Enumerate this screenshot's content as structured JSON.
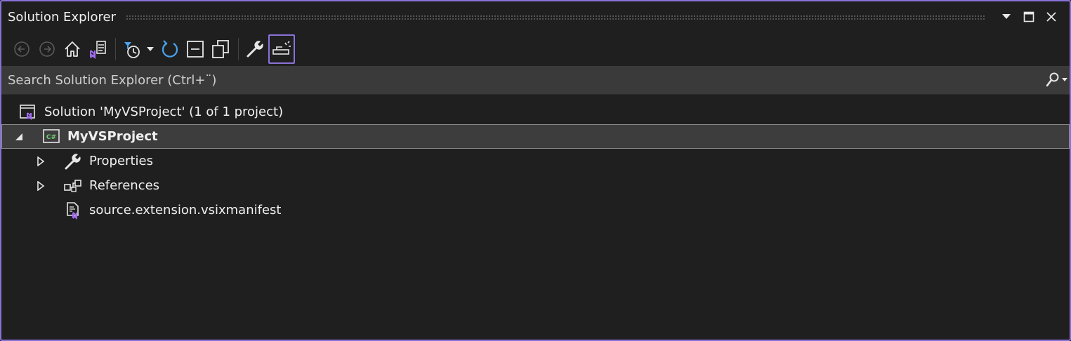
{
  "window": {
    "title": "Solution Explorer"
  },
  "toolbar": {
    "icons": [
      "back-icon",
      "forward-icon",
      "home-icon",
      "switch-views-icon",
      "pending-changes-filter-icon",
      "dropdown-arrow-icon",
      "sync-icon",
      "collapse-all-icon",
      "show-all-files-icon",
      "properties-icon",
      "preview-selected-icon"
    ]
  },
  "search": {
    "placeholder": "Search Solution Explorer (Ctrl+¨)"
  },
  "tree": {
    "solution": {
      "label": "Solution 'MyVSProject' (1 of 1 project)"
    },
    "project": {
      "label": "MyVSProject"
    },
    "items": [
      {
        "label": "Properties"
      },
      {
        "label": "References"
      },
      {
        "label": "source.extension.vsixmanifest"
      }
    ]
  },
  "colors": {
    "accent": "#8a72d8",
    "background": "#1f1f1f",
    "search_bg": "#3a3a3a",
    "selected_bg": "#3d3d3d",
    "refresh_blue": "#4aa3f0"
  }
}
